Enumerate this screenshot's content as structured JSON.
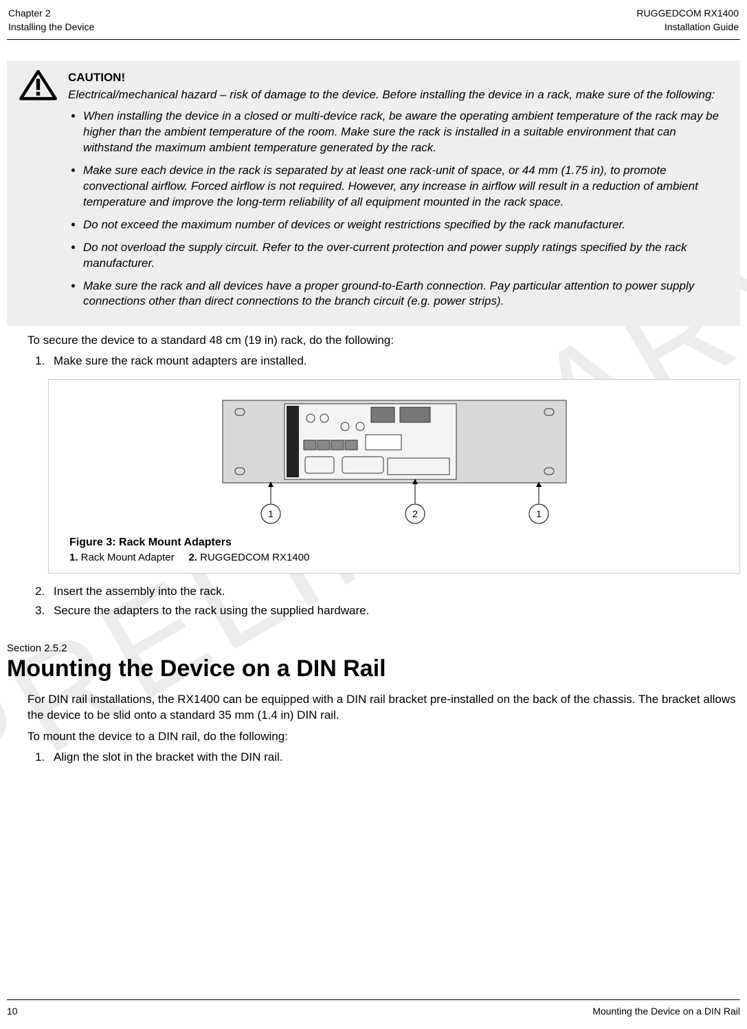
{
  "watermark": "PRELIMINARY",
  "header": {
    "left_line1": "Chapter 2",
    "left_line2": "Installing the Device",
    "right_line1": "RUGGEDCOM RX1400",
    "right_line2": "Installation Guide"
  },
  "caution": {
    "title": "CAUTION!",
    "intro": "Electrical/mechanical hazard – risk of damage to the device. Before installing the device in a rack, make sure of the following:",
    "items": [
      "When installing the device in a closed or multi-device rack, be aware the operating ambient temperature of the rack may be higher than the ambient temperature of the room. Make sure the rack is installed in a suitable environment that can withstand the maximum ambient temperature generated by the rack.",
      "Make sure each device in the rack is separated by at least one rack-unit of space, or 44 mm (1.75 in), to promote convectional airflow. Forced airflow is not required. However, any increase in airflow will result in a reduction of ambient temperature and improve the long-term reliability of all equipment mounted in the rack space.",
      "Do not exceed the maximum number of devices or weight restrictions specified by the rack manufacturer.",
      "Do not overload the supply circuit. Refer to the over-current protection and power supply ratings specified by the rack manufacturer.",
      "Make sure the rack and all devices have a proper ground-to-Earth connection. Pay particular attention to power supply connections other than direct connections to the branch circuit (e.g. power strips)."
    ]
  },
  "body": {
    "intro": "To secure the device to a standard 48 cm (19 in) rack, do the following:",
    "step1": "Make sure the rack mount adapters are installed.",
    "step2": "Insert the assembly into the rack.",
    "step3": "Secure the adapters to the rack using the supplied hardware."
  },
  "figure": {
    "caption": "Figure 3: Rack Mount Adapters",
    "legend_1_label": "1.",
    "legend_1_text": " Rack Mount Adapter",
    "legend_2_label": "2.",
    "legend_2_text": "  RUGGEDCOM RX1400",
    "callout_left": "1",
    "callout_center": "2",
    "callout_right": "1"
  },
  "section": {
    "label": "Section 2.5.2",
    "title": "Mounting the Device on a DIN Rail",
    "p1": "For DIN rail installations, the RX1400 can be equipped with a DIN rail bracket pre-installed on the back of the chassis. The bracket allows the device to be slid onto a standard 35 mm (1.4 in) DIN rail.",
    "p2": "To mount the device to a DIN rail, do the following:",
    "step1": "Align the slot in the bracket with the DIN rail."
  },
  "footer": {
    "left": "10",
    "right": "Mounting the Device on a DIN Rail"
  }
}
